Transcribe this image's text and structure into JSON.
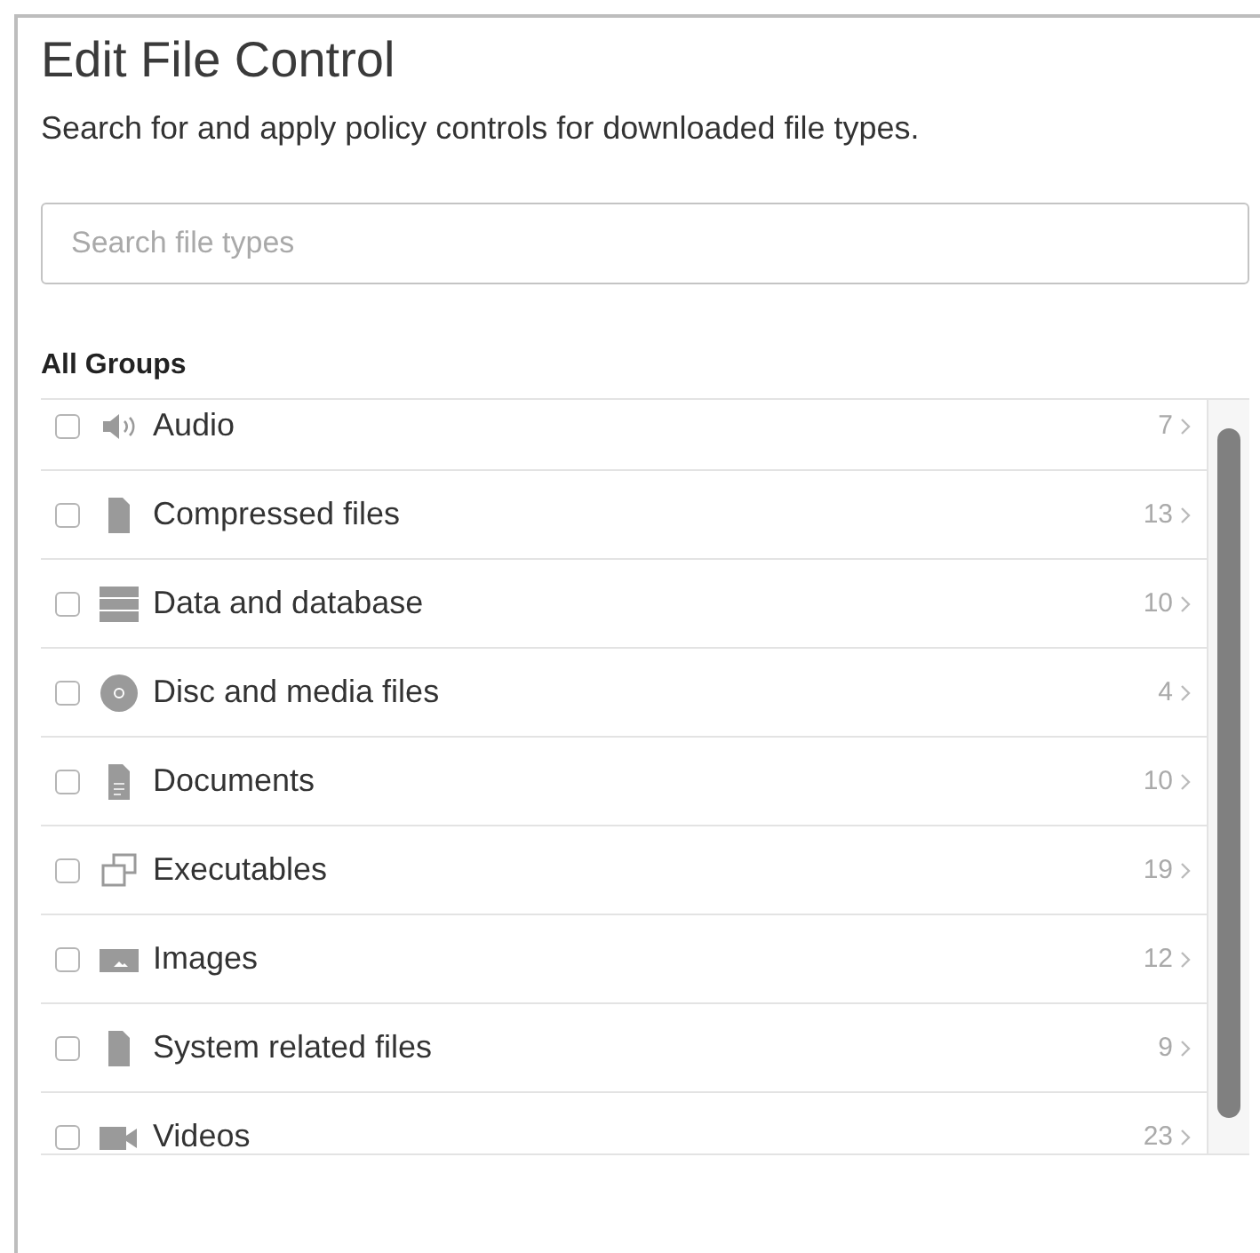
{
  "title": "Edit File Control",
  "description": "Search for and apply policy controls for downloaded file types.",
  "search": {
    "placeholder": "Search file types"
  },
  "groups_heading": "All Groups",
  "groups": [
    {
      "kind": "speaker",
      "label": "Audio",
      "count": "7",
      "checked": false
    },
    {
      "kind": "file",
      "label": "Compressed files",
      "count": "13",
      "checked": false
    },
    {
      "kind": "database",
      "label": "Data and database",
      "count": "10",
      "checked": false
    },
    {
      "kind": "disc",
      "label": "Disc and media files",
      "count": "4",
      "checked": false
    },
    {
      "kind": "document",
      "label": "Documents",
      "count": "10",
      "checked": false
    },
    {
      "kind": "windows",
      "label": "Executables",
      "count": "19",
      "checked": false
    },
    {
      "kind": "image",
      "label": "Images",
      "count": "12",
      "checked": false
    },
    {
      "kind": "file",
      "label": "System related files",
      "count": "9",
      "checked": false
    },
    {
      "kind": "camera",
      "label": "Videos",
      "count": "23",
      "checked": false
    }
  ]
}
